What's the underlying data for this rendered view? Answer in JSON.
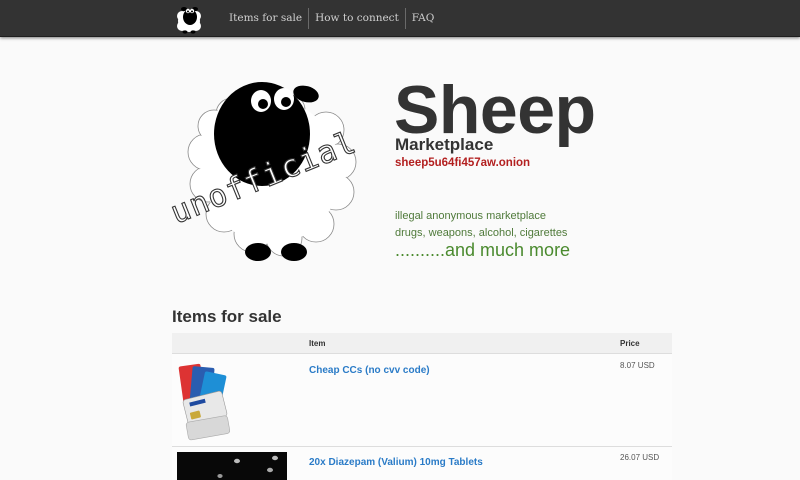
{
  "nav": {
    "logo_icon": "sheep-logo-icon",
    "links": [
      "Items for sale",
      "How to connect",
      "FAQ"
    ]
  },
  "hero": {
    "title": "Sheep",
    "subtitle": "Marketplace",
    "onion": "sheep5u64fi457aw.onion",
    "stamp": "unofficial",
    "tagline1": "illegal anonymous marketplace",
    "tagline2": "drugs, weapons, alcohol, cigarettes",
    "more": "..........and much more"
  },
  "items": {
    "heading": "Items for sale",
    "columns": {
      "item": "Item",
      "price": "Price"
    },
    "rows": [
      {
        "name": "Cheap CCs (no cvv code)",
        "price": "8.07 USD",
        "thumb_icon": "credit-cards-image"
      },
      {
        "name": "20x Diazepam (Valium) 10mg Tablets",
        "price": "26.07 USD",
        "thumb_icon": "tablets-image"
      }
    ]
  },
  "colors": {
    "navbar": "#333333",
    "onion": "#b32020",
    "tagline": "#4f7a3a",
    "link": "#2a7bc7"
  }
}
